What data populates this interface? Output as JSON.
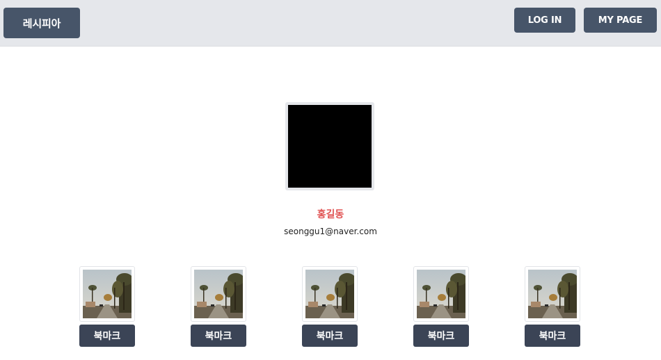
{
  "header": {
    "brand_label": "레시피아",
    "login_label": "LOG IN",
    "mypage_label": "MY PAGE"
  },
  "profile": {
    "name": "홍길동",
    "email": "seonggu1@naver.com"
  },
  "bookmarks": [
    {
      "label": "북마크"
    },
    {
      "label": "북마크"
    },
    {
      "label": "북마크"
    },
    {
      "label": "북마크"
    },
    {
      "label": "북마크"
    }
  ],
  "colors": {
    "header_bg": "#e5e7eb",
    "button_bg": "#475569",
    "bookmark_bg": "#3b4456",
    "name_accent": "#e05353"
  }
}
